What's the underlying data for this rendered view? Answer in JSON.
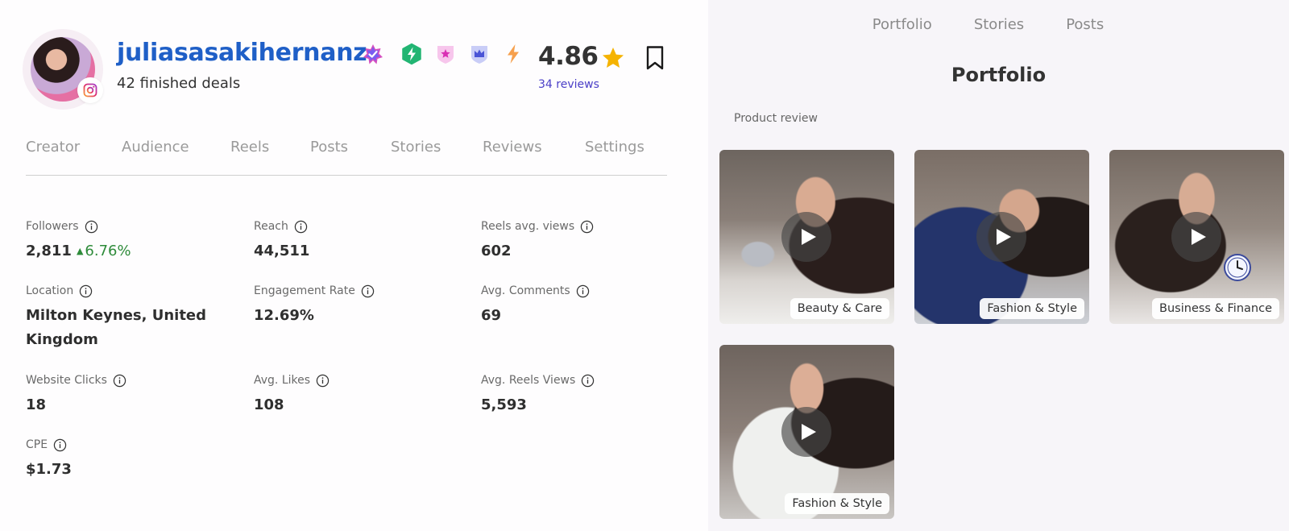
{
  "profile": {
    "username": "juliasasakihernanz",
    "finished_deals": "42 finished deals",
    "rating": "4.86",
    "reviews": "34 reviews"
  },
  "badges": [
    "verified-star-icon",
    "lightning-hex-icon",
    "star-shield-icon",
    "crown-shield-icon",
    "bolt-icon"
  ],
  "tabs": [
    "Creator",
    "Audience",
    "Reels",
    "Posts",
    "Stories",
    "Reviews",
    "Settings"
  ],
  "stats": {
    "followers": {
      "label": "Followers",
      "value": "2,811",
      "growth": "6.76%"
    },
    "reach": {
      "label": "Reach",
      "value": "44,511"
    },
    "reels_avg_views": {
      "label": "Reels avg. views",
      "value": "602"
    },
    "location": {
      "label": "Location",
      "value_line1": "Milton Keynes, United",
      "value_line2": "Kingdom"
    },
    "engagement_rate": {
      "label": "Engagement Rate",
      "value": "12.69%"
    },
    "avg_comments": {
      "label": "Avg. Comments",
      "value": "69"
    },
    "website_clicks": {
      "label": "Website Clicks",
      "value": "18"
    },
    "avg_likes": {
      "label": "Avg. Likes",
      "value": "108"
    },
    "avg_reels_views": {
      "label": "Avg. Reels Views",
      "value": "5,593"
    },
    "cpe": {
      "label": "CPE",
      "value": "$1.73"
    }
  },
  "right_panel": {
    "tabs": [
      "Portfolio",
      "Stories",
      "Posts"
    ],
    "title": "Portfolio",
    "category": "Product review",
    "videos": [
      {
        "tag": "Beauty & Care"
      },
      {
        "tag": "Fashion & Style"
      },
      {
        "tag": "Business & Finance"
      },
      {
        "tag": "Fashion & Style"
      }
    ]
  },
  "colors": {
    "username": "#1f5fc7",
    "growth": "#2e8b3a",
    "reviews_link": "#4a3fc7",
    "star": "#f5b301"
  }
}
